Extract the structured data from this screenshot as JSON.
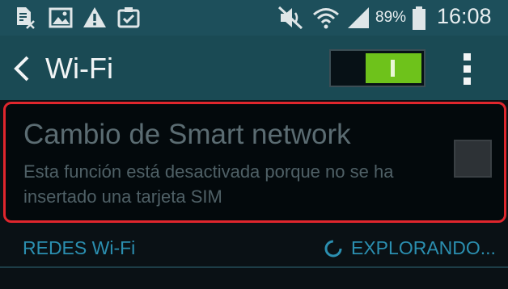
{
  "status_bar": {
    "icons": [
      "sim-card-blocked-icon",
      "image-icon",
      "warning-icon",
      "clipboard-check-icon",
      "mute-icon",
      "wifi-icon",
      "signal-icon",
      "battery-icon"
    ],
    "battery_percent": "89%",
    "time": "16:08"
  },
  "action_bar": {
    "title": "Wi-Fi",
    "toggle_state": "on",
    "accent_color": "#6ec21b"
  },
  "smart_network": {
    "title": "Cambio de Smart network",
    "description": "Esta función está desactivada porque no se ha insertado una tarjeta SIM",
    "checked": false,
    "highlight_color": "#e0262d"
  },
  "wifi_section": {
    "title": "REDES Wi-Fi",
    "status": "EXPLORANDO..."
  }
}
